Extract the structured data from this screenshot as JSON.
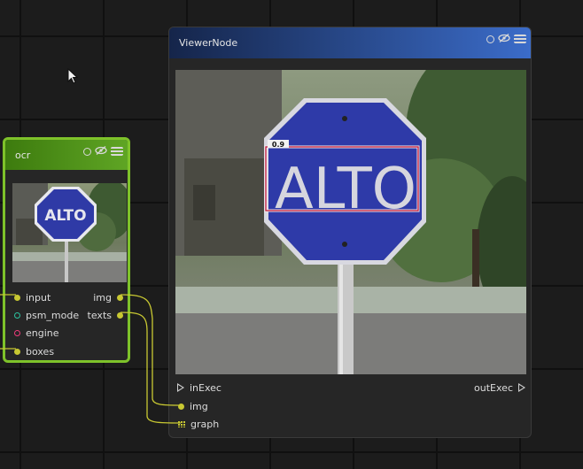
{
  "ocr_node": {
    "title": "ocr",
    "inputs": [
      "input",
      "psm_mode",
      "engine",
      "boxes"
    ],
    "outputs": [
      "img",
      "texts"
    ],
    "preview_text": "ALTO"
  },
  "viewer_node": {
    "title": "ViewerNode",
    "exec_in": "inExec",
    "exec_out": "outExec",
    "inputs": [
      "img",
      "graph"
    ],
    "preview_text": "ALTO",
    "detection_label": "0.9"
  },
  "colors": {
    "ocr_accent": "#7ec22a",
    "viewer_header": "#3b6cc9",
    "data_port": "#c8c832",
    "psm_port": "#2cc4a0",
    "engine_port": "#f03a7a",
    "detection_box": "#c0163a"
  },
  "icons": [
    "refresh-icon",
    "eye-off-icon",
    "menu-icon",
    "exec-triangle-icon",
    "grid-icon",
    "mouse-cursor-icon"
  ]
}
